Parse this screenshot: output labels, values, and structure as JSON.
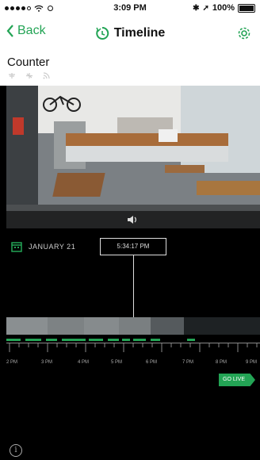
{
  "status_bar": {
    "time": "3:09 PM",
    "battery": "100%"
  },
  "nav": {
    "back_label": "Back",
    "title": "Timeline"
  },
  "camera": {
    "name": "Counter"
  },
  "timeline": {
    "date": "JANUARY 21",
    "current_time": "5:34:17 PM",
    "hour_labels": [
      "2 PM",
      "3 PM",
      "4 PM",
      "5 PM",
      "6 PM",
      "7 PM",
      "8 PM",
      "9 PM"
    ],
    "go_live_label": "GO LIVE",
    "info_symbol": "i"
  },
  "colors": {
    "accent": "#23a455",
    "background": "#000000"
  },
  "icons": [
    "back-chevron-icon",
    "timeline-icon",
    "settings-gear-icon",
    "calendar-icon",
    "volume-icon",
    "info-icon"
  ]
}
